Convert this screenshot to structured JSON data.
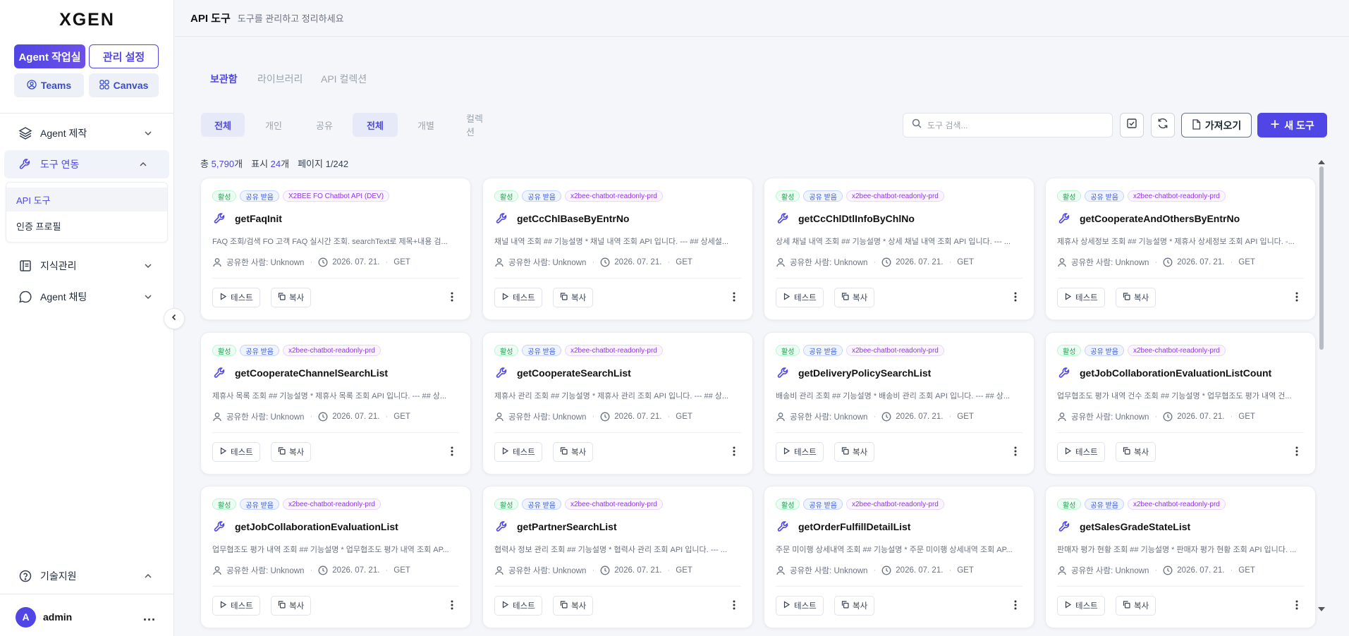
{
  "sidebar": {
    "logo": "XGEN",
    "mode_agent": "Agent 작업실",
    "mode_admin": "관리 설정",
    "teams": "Teams",
    "canvas": "Canvas",
    "nav_agent_build": "Agent 제작",
    "nav_tools": "도구 연동",
    "sub_api_tools": "API 도구",
    "sub_auth_profile": "인증 프로필",
    "nav_knowledge": "지식관리",
    "nav_agent_chat": "Agent 채팅",
    "nav_support": "기술지원",
    "user_avatar": "A",
    "user_name": "admin",
    "user_more": "..."
  },
  "header": {
    "title": "API 도구",
    "subtitle": "도구를 관리하고 정리하세요"
  },
  "tabs": {
    "vault": "보관함",
    "library": "라이브러리",
    "api_collection": "API 컬렉션"
  },
  "filters": {
    "all1": "전체",
    "personal": "개인",
    "shared": "공유",
    "all2": "전체",
    "individual": "개별",
    "collection": "컬렉션"
  },
  "search": {
    "placeholder": "도구 검색..."
  },
  "toolbar": {
    "import": "가져오기",
    "new_tool": "새 도구"
  },
  "stats": {
    "total_label": "총",
    "total_count": "5,790",
    "total_unit": "개",
    "shown_label": "표시",
    "shown_count": "24",
    "shown_unit": "개",
    "page_label": "페이지 1/242"
  },
  "card_common": {
    "tag_active": "활성",
    "tag_shared": "공유 받음",
    "shared_by": "공유한 사람: Unknown",
    "date": "2026. 07. 21.",
    "method": "GET",
    "test_label": "테스트",
    "copy_label": "복사"
  },
  "cards": [
    {
      "source": "X2BEE FO Chatbot API (DEV)",
      "name": "getFaqInit",
      "desc": "FAQ 조회/검색 FO 고객 FAQ 실시간 조회. searchText로 제목+내용 검..."
    },
    {
      "source": "x2bee-chatbot-readonly-prd",
      "name": "getCcChlBaseByEntrNo",
      "desc": "채널 내역 조회 ## 기능설명 * 채널 내역 조회 API 입니다. --- ## 상세설..."
    },
    {
      "source": "x2bee-chatbot-readonly-prd",
      "name": "getCcChlDtlInfoByChlNo",
      "desc": "상세 채널 내역 조회 ## 기능설명 * 상세 채널 내역 조회 API 입니다. --- ..."
    },
    {
      "source": "x2bee-chatbot-readonly-prd",
      "name": "getCooperateAndOthersByEntrNo",
      "desc": "제휴사 상세정보 조회 ## 기능설명 * 제휴사 상세정보 조회 API 입니다. -..."
    },
    {
      "source": "x2bee-chatbot-readonly-prd",
      "name": "getCooperateChannelSearchList",
      "desc": "제휴사 목록 조회 ## 기능설명 * 제휴사 목록 조회 API 입니다. --- ## 상..."
    },
    {
      "source": "x2bee-chatbot-readonly-prd",
      "name": "getCooperateSearchList",
      "desc": "제휴사 관리 조회 ## 기능설명 * 제휴사 관리 조회 API 입니다. --- ## 상..."
    },
    {
      "source": "x2bee-chatbot-readonly-prd",
      "name": "getDeliveryPolicySearchList",
      "desc": "배송비 관리 조회 ## 기능설명 * 배송비 관리 조회 API 입니다. --- ## 상..."
    },
    {
      "source": "x2bee-chatbot-readonly-prd",
      "name": "getJobCollaborationEvaluationListCount",
      "desc": "업무협조도 평가 내역 건수 조회 ## 기능설명 * 업무협조도 평가 내역 건..."
    },
    {
      "source": "x2bee-chatbot-readonly-prd",
      "name": "getJobCollaborationEvaluationList",
      "desc": "업무협조도 평가 내역 조회 ## 기능설명 * 업무협조도 평가 내역 조회 AP..."
    },
    {
      "source": "x2bee-chatbot-readonly-prd",
      "name": "getPartnerSearchList",
      "desc": "협력사 정보 관리 조회 ## 기능설명 * 협력사 관리 조회 API 입니다. --- ..."
    },
    {
      "source": "x2bee-chatbot-readonly-prd",
      "name": "getOrderFulfillDetailList",
      "desc": "주문 미이행 상세내역 조회 ## 기능설명 * 주문 미이행 상세내역 조회 AP..."
    },
    {
      "source": "x2bee-chatbot-readonly-prd",
      "name": "getSalesGradeStateList",
      "desc": "판매자 평가 현황 조회 ## 기능설명 * 판매자 평가 현황 조회 API 입니다. ..."
    }
  ],
  "colors": {
    "accent": "#4f46e5",
    "background": "#f5f6fa"
  }
}
